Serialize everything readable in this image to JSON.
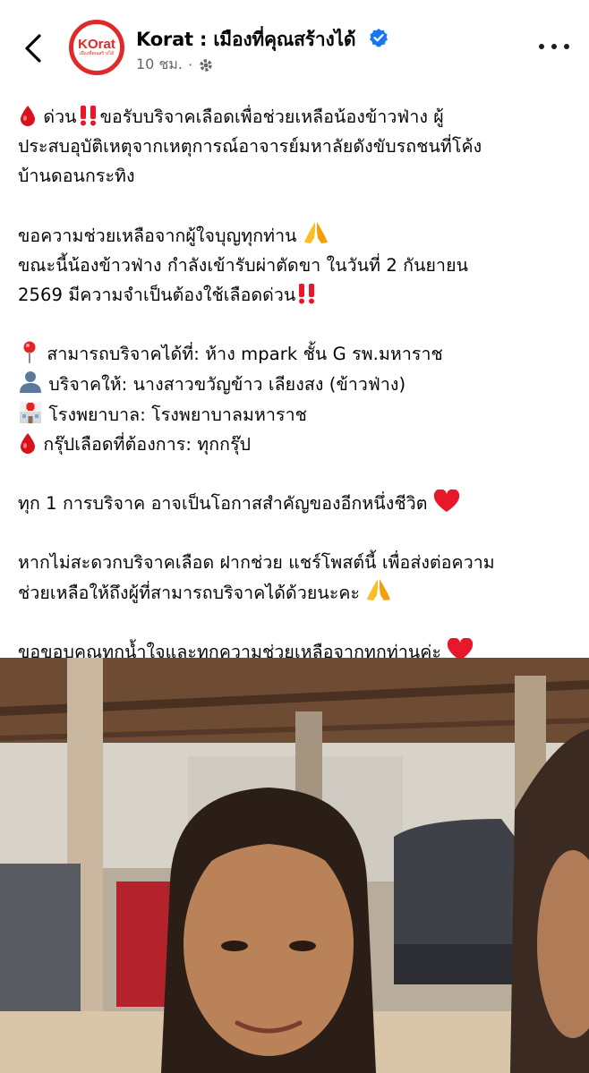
{
  "header": {
    "page_name": "Korat : เมืองที่คุณสร้างได้",
    "time": "10 ชม.",
    "separator": "·",
    "avatar_logo": "KOrat",
    "avatar_sub": "เมืองที่คุณสร้างได้",
    "icons": [
      "back-arrow-icon",
      "verified-badge-icon",
      "globe-icon",
      "more-icon"
    ],
    "accent_color": "#e02a2a",
    "verified_color": "#1877f2"
  },
  "post": {
    "line1a": "ด่วน",
    "line1b": "ขอรับบริจาคเลือดเพื่อช่วยเหลือน้องข้าวฟ่าง ผู้",
    "line2": "ประสบอุบัติเหตุจากเหตุการณ์อาจารย์มหาลัยดังขับรถชนที่โค้ง",
    "line3": "บ้านดอนกระทิง",
    "p2_line1": "ขอความช่วยเหลือจากผู้ใจบุญทุกท่าน",
    "p2_line2": "ขณะนี้น้องข้าวฟ่าง กำลังเข้ารับผ่าตัดขา ในวันที่ 2 กันยายน",
    "p2_line3": "2569 มีความจำเป็นต้องใช้เลือดด่วน",
    "location": "สามารถบริจาคได้ที่: ห้าง mpark ชั้น G รพ.มหาราช",
    "recipient": "บริจาคให้: นางสาวขวัญข้าว เลียงสง (ข้าวฟ่าง)",
    "hospital": "โรงพยาบาล: โรงพยาบาลมหาราช",
    "blood_type": "กรุ๊ปเลือดที่ต้องการ: ทุกกรุ๊ป",
    "p4": "ทุก 1 การบริจาค อาจเป็นโอกาสสำคัญของอีกหนึ่งชีวิต",
    "p5_line1": "หากไม่สะดวกบริจาคเลือด ฝากช่วย แชร์โพสต์นี้ เพื่อส่งต่อความ",
    "p5_line2": "ช่วยเหลือให้ถึงผู้ที่สามารถบริจาคได้ด้วยนะคะ",
    "p6": "ขอขอบคุณทุกน้ำใจและทุกความช่วยเหลือจากทุกท่านค่ะ",
    "emoji_icons": [
      "blood-drop-icon",
      "double-exclamation-icon",
      "praying-hands-icon",
      "pin-icon",
      "person-icon",
      "hospital-icon",
      "red-heart-icon"
    ]
  }
}
